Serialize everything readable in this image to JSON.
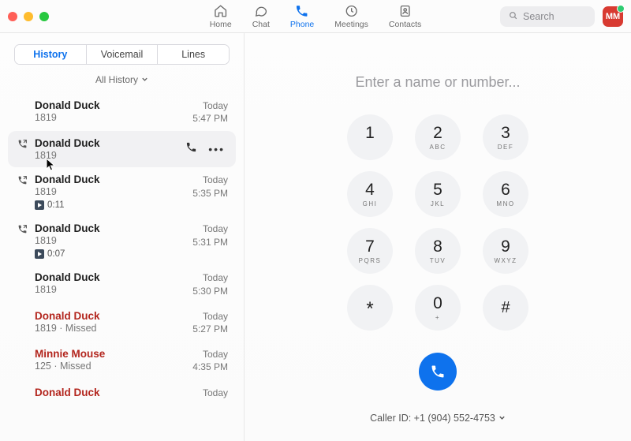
{
  "nav": {
    "home": "Home",
    "chat": "Chat",
    "phone": "Phone",
    "meetings": "Meetings",
    "contacts": "Contacts",
    "search_placeholder": "Search",
    "avatar_initials": "MM"
  },
  "tabs": {
    "history": "History",
    "voicemail": "Voicemail",
    "lines": "Lines"
  },
  "filter": {
    "label": "All History"
  },
  "history": [
    {
      "name": "Donald Duck",
      "ext": "1819",
      "date": "Today",
      "time": "5:47 PM",
      "missed": false,
      "status": "none",
      "voicemail": null
    },
    {
      "name": "Donald Duck",
      "ext": "1819",
      "date": "",
      "time": "",
      "missed": false,
      "status": "outgoing",
      "voicemail": null,
      "hovered": true
    },
    {
      "name": "Donald Duck",
      "ext": "1819",
      "date": "Today",
      "time": "5:35 PM",
      "missed": false,
      "status": "outgoing",
      "voicemail": "0:11"
    },
    {
      "name": "Donald Duck",
      "ext": "1819",
      "date": "Today",
      "time": "5:31 PM",
      "missed": false,
      "status": "outgoing",
      "voicemail": "0:07"
    },
    {
      "name": "Donald Duck",
      "ext": "1819",
      "date": "Today",
      "time": "5:30 PM",
      "missed": false,
      "status": "none",
      "voicemail": null
    },
    {
      "name": "Donald Duck",
      "ext": "1819 · Missed",
      "date": "Today",
      "time": "5:27 PM",
      "missed": true,
      "status": "none",
      "voicemail": null
    },
    {
      "name": "Minnie Mouse",
      "ext": "125 · Missed",
      "date": "Today",
      "time": "4:35 PM",
      "missed": true,
      "status": "none",
      "voicemail": null
    },
    {
      "name": "Donald Duck",
      "ext": "",
      "date": "Today",
      "time": "",
      "missed": true,
      "status": "none",
      "voicemail": null
    }
  ],
  "dialer": {
    "placeholder": "Enter a name or number...",
    "keys": [
      {
        "d": "1",
        "l": ""
      },
      {
        "d": "2",
        "l": "ABC"
      },
      {
        "d": "3",
        "l": "DEF"
      },
      {
        "d": "4",
        "l": "GHI"
      },
      {
        "d": "5",
        "l": "JKL"
      },
      {
        "d": "6",
        "l": "MNO"
      },
      {
        "d": "7",
        "l": "PQRS"
      },
      {
        "d": "8",
        "l": "TUV"
      },
      {
        "d": "9",
        "l": "WXYZ"
      },
      {
        "d": "*",
        "l": ""
      },
      {
        "d": "0",
        "l": "+"
      },
      {
        "d": "#",
        "l": ""
      }
    ],
    "caller_id": "Caller ID: +1 (904) 552-4753"
  }
}
